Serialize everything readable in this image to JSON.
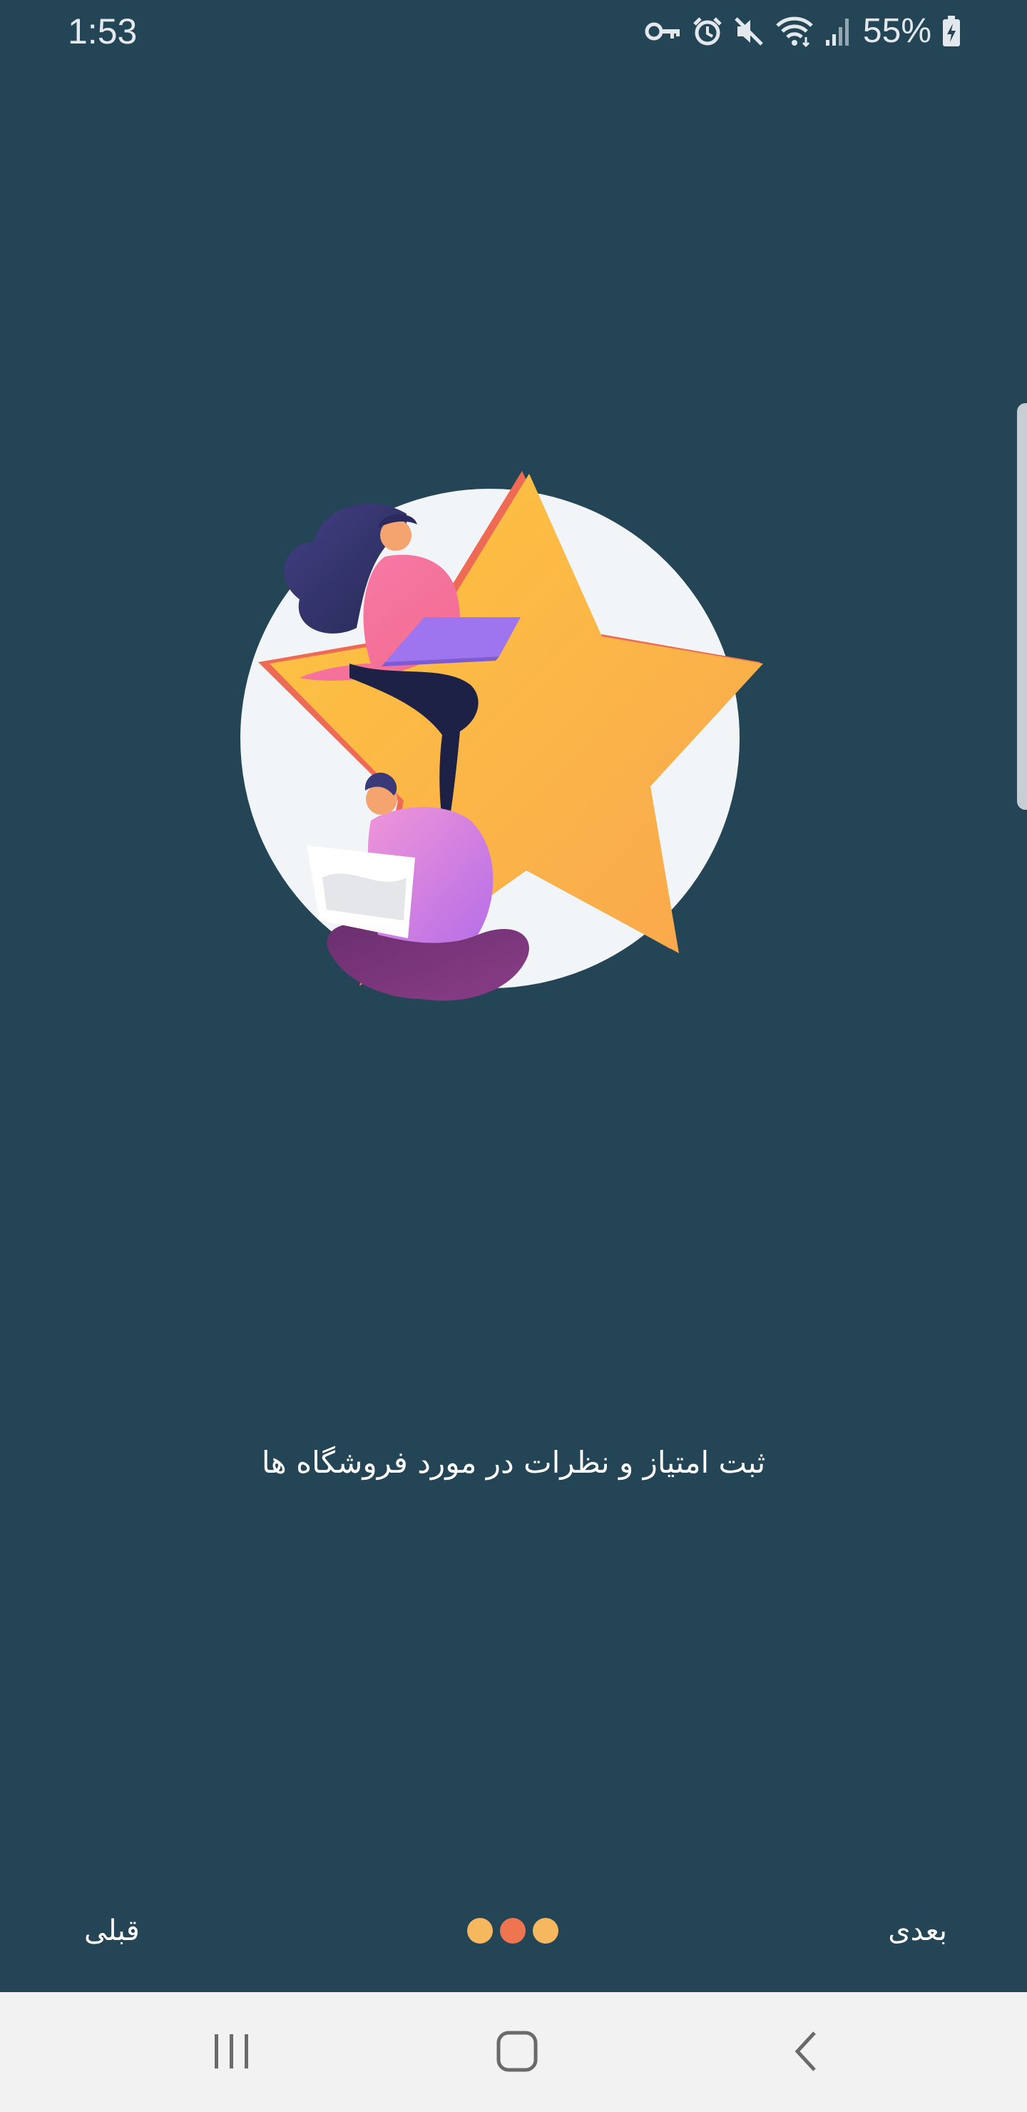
{
  "status_bar": {
    "time": "1:53",
    "battery_percent": "55%",
    "icons": [
      "key-icon",
      "alarm-icon",
      "mute-icon",
      "wifi-icon",
      "signal-icon",
      "battery-charging-icon"
    ]
  },
  "onboarding": {
    "caption": "ثبت امتیاز و نظرات در مورد فروشگاه ها",
    "prev_label": "قبلی",
    "next_label": "بعدی",
    "page_indicator": {
      "total": 3,
      "current": 2,
      "colors": [
        "#f6b85e",
        "#ef7450",
        "#f6b85e"
      ]
    }
  },
  "nav_bar": {
    "buttons": [
      "recents-icon",
      "home-icon",
      "back-icon"
    ]
  },
  "colors": {
    "background": "#244555",
    "star": "#fbb540",
    "circle": "#f2f5f8",
    "nav_bar": "#f2f2f2"
  }
}
